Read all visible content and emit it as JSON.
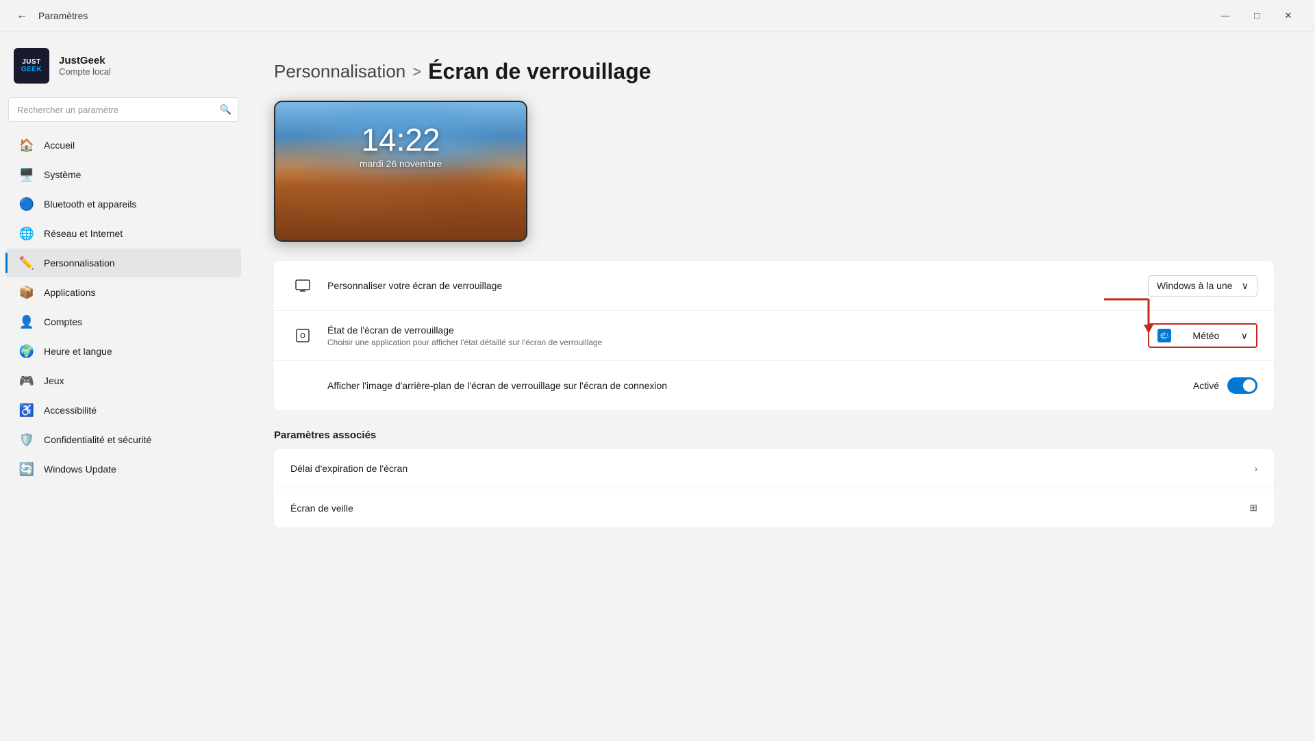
{
  "titlebar": {
    "title": "Paramètres",
    "back_label": "←",
    "minimize_label": "—",
    "maximize_label": "□",
    "close_label": "✕"
  },
  "sidebar": {
    "brand": {
      "logo_line1": "JUST",
      "logo_line2": "GEEK",
      "user_name": "JustGeek",
      "user_role": "Compte local"
    },
    "search_placeholder": "Rechercher un paramètre",
    "nav_items": [
      {
        "id": "accueil",
        "label": "Accueil",
        "icon": "🏠"
      },
      {
        "id": "systeme",
        "label": "Système",
        "icon": "🖥️"
      },
      {
        "id": "bluetooth",
        "label": "Bluetooth et appareils",
        "icon": "🔵"
      },
      {
        "id": "reseau",
        "label": "Réseau et Internet",
        "icon": "🌐"
      },
      {
        "id": "personnalisation",
        "label": "Personnalisation",
        "icon": "✏️",
        "active": true
      },
      {
        "id": "applications",
        "label": "Applications",
        "icon": "📦"
      },
      {
        "id": "comptes",
        "label": "Comptes",
        "icon": "👤"
      },
      {
        "id": "heure",
        "label": "Heure et langue",
        "icon": "🌍"
      },
      {
        "id": "jeux",
        "label": "Jeux",
        "icon": "🎮"
      },
      {
        "id": "accessibilite",
        "label": "Accessibilité",
        "icon": "♿"
      },
      {
        "id": "confidentialite",
        "label": "Confidentialité et sécurité",
        "icon": "🛡️"
      },
      {
        "id": "windows-update",
        "label": "Windows Update",
        "icon": "🔄"
      }
    ]
  },
  "content": {
    "breadcrumb_parent": "Personnalisation",
    "breadcrumb_sep": ">",
    "breadcrumb_current": "Écran de verrouillage",
    "lockscreen": {
      "time": "14:22",
      "date": "mardi 26 novembre"
    },
    "settings": [
      {
        "id": "personnaliser",
        "icon": "🖥",
        "title": "Personnaliser votre écran de verrouillage",
        "subtitle": "",
        "control_type": "dropdown",
        "control_value": "Windows à la une"
      },
      {
        "id": "etat",
        "icon": "⬜",
        "title": "État de l'écran de verrouillage",
        "subtitle": "Choisir une application pour afficher l'état détaillé sur l'écran de verrouillage",
        "control_type": "dropdown-highlighted",
        "control_value": "Météo"
      },
      {
        "id": "arriere-plan",
        "icon": "",
        "title": "Afficher l'image d'arrière-plan de l'écran de verrouillage sur l'écran de connexion",
        "subtitle": "",
        "control_type": "toggle",
        "control_value": "Activé"
      }
    ],
    "section_heading": "Paramètres associés",
    "associated_items": [
      {
        "id": "delai",
        "label": "Délai d'expiration de l'écran",
        "icon": "›"
      },
      {
        "id": "veille",
        "label": "Écran de veille",
        "icon": "⊞"
      }
    ]
  }
}
